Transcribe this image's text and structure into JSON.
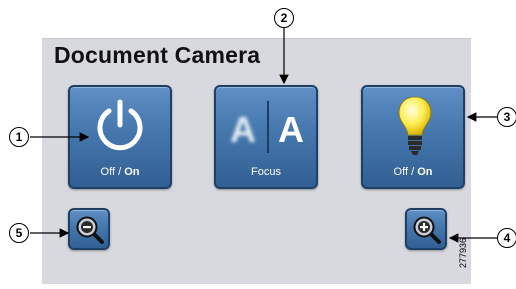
{
  "panel": {
    "title": "Document Camera"
  },
  "buttons": {
    "power": {
      "label_part1": "Off",
      "label_sep": " / ",
      "label_part2": "On"
    },
    "focus": {
      "label": "Focus",
      "letter_left": "A",
      "letter_right": "A"
    },
    "light": {
      "label_part1": "Off",
      "label_sep": " / ",
      "label_part2": "On"
    },
    "zoom_out": {
      "icon": "zoom-out-icon"
    },
    "zoom_in": {
      "icon": "zoom-in-icon"
    }
  },
  "callouts": [
    "1",
    "2",
    "3",
    "4",
    "5"
  ],
  "figure_id": "277936",
  "colors": {
    "button_blue": "#4577ad",
    "button_border": "#1e3f66",
    "panel_bg": "#d7d9de",
    "bulb_yellow": "#ffee55"
  }
}
